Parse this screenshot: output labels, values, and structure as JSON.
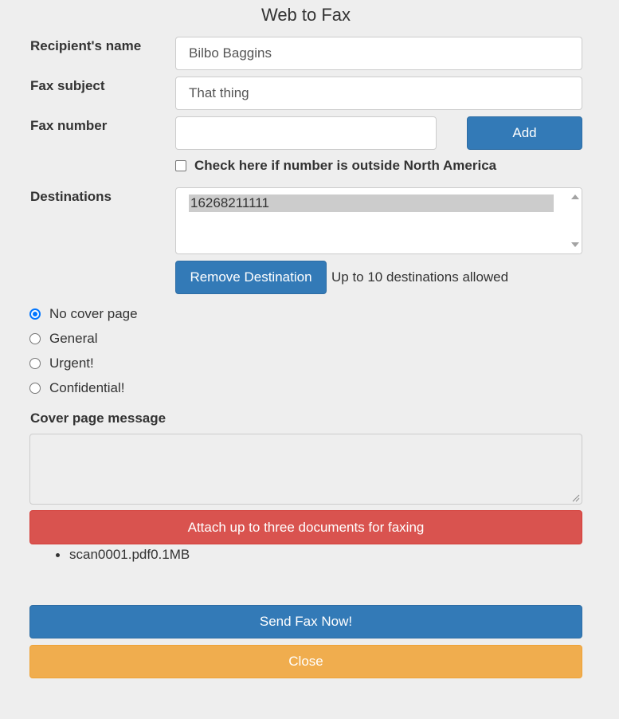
{
  "header": {
    "title": "Web to Fax"
  },
  "form": {
    "recipient_label": "Recipient's name",
    "recipient_value": "Bilbo Baggins",
    "subject_label": "Fax subject",
    "subject_value": "That thing",
    "fax_number_label": "Fax number",
    "fax_number_value": "",
    "add_button": "Add",
    "outside_na_label": "Check here if number is outside North America",
    "outside_na_checked": false,
    "destinations_label": "Destinations",
    "destinations": [
      "16268211111"
    ],
    "remove_destination_button": "Remove Destination",
    "destinations_help": "Up to 10 destinations allowed",
    "cover_options": [
      {
        "label": "No cover page",
        "checked": true
      },
      {
        "label": "General",
        "checked": false
      },
      {
        "label": "Urgent!",
        "checked": false
      },
      {
        "label": "Confidential!",
        "checked": false
      }
    ],
    "cover_message_label": "Cover page message",
    "cover_message_value": "",
    "attach_button": "Attach up to three documents for faxing",
    "attachments": [
      {
        "text": "scan0001.pdf0.1MB"
      }
    ],
    "send_button": "Send Fax Now!",
    "close_button": "Close"
  },
  "colors": {
    "primary": "#337ab7",
    "danger": "#d9534f",
    "warning": "#f0ad4e",
    "radio_accent": "#0075ff",
    "background": "#eeeeee"
  }
}
